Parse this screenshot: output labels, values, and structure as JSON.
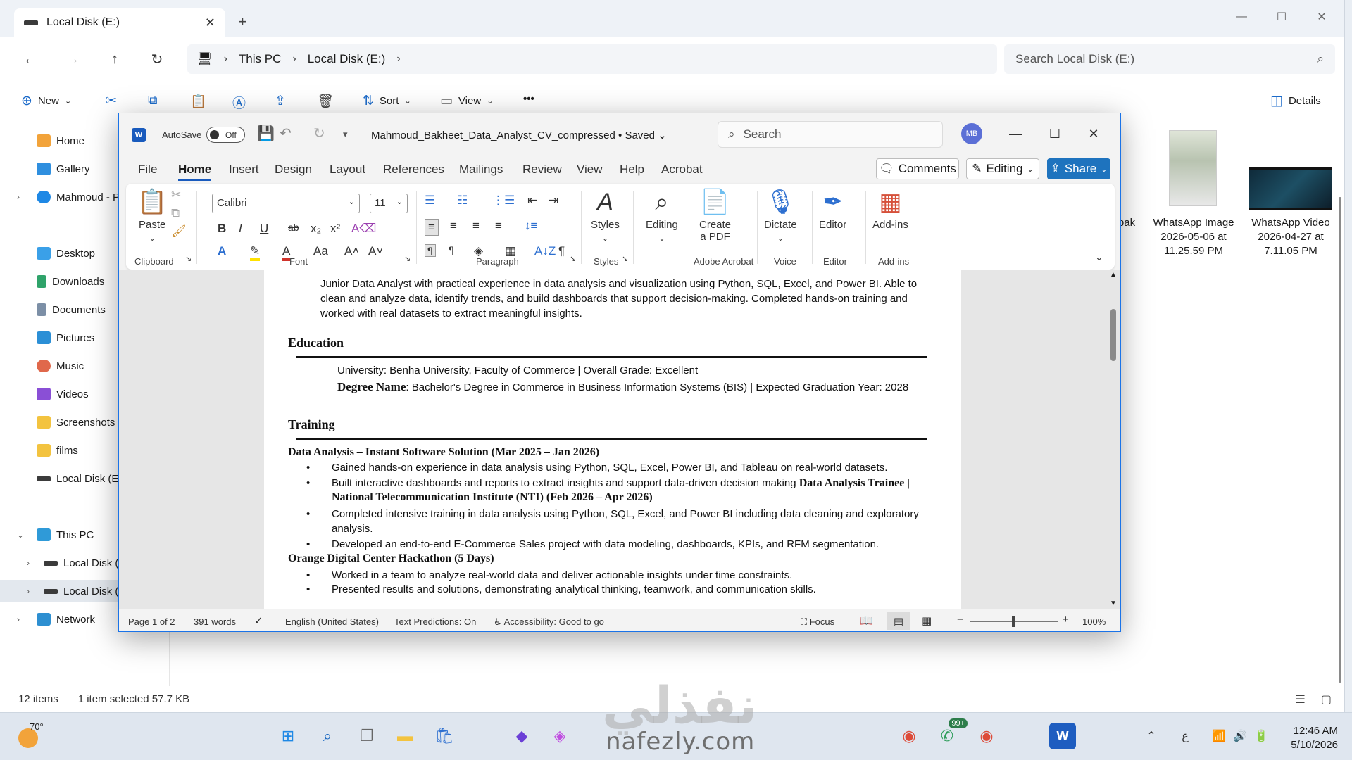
{
  "explorer": {
    "tab_title": "Local Disk (E:)",
    "breadcrumb": [
      "This PC",
      "Local Disk (E:)"
    ],
    "search_placeholder": "Search Local Disk (E:)",
    "toolbar": {
      "new_label": "New",
      "sort_label": "Sort",
      "view_label": "View",
      "more_label": "•••",
      "details_label": "Details"
    },
    "nav": {
      "home": "Home",
      "gallery": "Gallery",
      "onedrive": "Mahmoud - P",
      "desktop": "Desktop",
      "downloads": "Downloads",
      "documents": "Documents",
      "pictures": "Pictures",
      "music": "Music",
      "videos": "Videos",
      "screenshots": "Screenshots",
      "films": "films",
      "local_disk_quick": "Local Disk (E:)",
      "this_pc": "This PC",
      "local_disk_c": "Local Disk (C",
      "local_disk_e": "Local Disk (E",
      "network": "Network"
    },
    "files": [
      {
        "name": "bak",
        "date": ""
      },
      {
        "name": "WhatsApp Image",
        "date": "2026-05-06 at",
        "time": "11.25.59 PM"
      },
      {
        "name": "WhatsApp Video",
        "date": "2026-04-27 at",
        "time": "7.11.05 PM"
      }
    ],
    "status": {
      "items": "12 items",
      "selection": "1 item selected  57.7 KB"
    }
  },
  "word": {
    "autosave_label": "AutoSave",
    "autosave_state": "Off",
    "doc_title": "Mahmoud_Bakheet_Data_Analyst_CV_compressed • Saved",
    "search_placeholder": "Search",
    "avatar_initials": "MB",
    "menu": [
      "File",
      "Home",
      "Insert",
      "Design",
      "Layout",
      "References",
      "Mailings",
      "Review",
      "View",
      "Help",
      "Acrobat"
    ],
    "comments_label": "Comments",
    "editing_label": "Editing",
    "share_label": "Share",
    "ribbon": {
      "paste_label": "Paste",
      "clipboard_group": "Clipboard",
      "font_name": "Calibri",
      "font_size": "11",
      "font_group": "Font",
      "paragraph_group": "Paragraph",
      "styles_label": "Styles",
      "styles_group": "Styles",
      "editing_label": "Editing",
      "create_pdf_line1": "Create",
      "create_pdf_line2": "a PDF",
      "acrobat_group": "Adobe Acrobat",
      "dictate_label": "Dictate",
      "voice_group": "Voice",
      "editor_label": "Editor",
      "editor_group": "Editor",
      "addins_label": "Add-ins",
      "addins_group": "Add-ins"
    },
    "document": {
      "summary_line1": "Junior Data Analyst with practical experience in data analysis and visualization using Python, SQL, Excel, and Power BI. Able to",
      "summary_line2": "clean and analyze data, identify trends, and build dashboards that support decision-making. Completed hands-on training and",
      "summary_line3": "worked with real datasets to extract meaningful insights.",
      "education_heading": "Education",
      "university_line": "University: Benha University, Faculty of Commerce | Overall Grade: Excellent",
      "degree_label": "Degree Name",
      "degree_text": ": Bachelor's Degree in Commerce in Business Information Systems (BIS) | Expected Graduation Year: 2028",
      "training_heading": "Training",
      "training1_title": "Data Analysis – Instant Software Solution (Mar 2025 – Jan 2026)",
      "training1_b1": "Gained hands-on experience in data analysis using Python, SQL, Excel, Power BI, and Tableau on real-world datasets.",
      "training1_b2": "Built interactive dashboards and reports to extract insights and support data-driven decision making ",
      "training2_inline": "Data Analysis Trainee |",
      "training2_line2": "National Telecommunication Institute (NTI) (Feb 2026 – Apr 2026)",
      "training2_b1_line1": "Completed intensive training in data analysis using Python, SQL, Excel, and Power BI including data cleaning and exploratory",
      "training2_b1_line2": "analysis.",
      "training2_b2": "Developed an end-to-end E-Commerce Sales project with data modeling, dashboards, KPIs, and RFM segmentation.",
      "training3_title": "Orange Digital Center Hackathon (5 Days)",
      "training3_b1": "Worked in a team to analyze real-world data and deliver actionable insights under time constraints.",
      "training3_b2": "Presented results and solutions, demonstrating analytical thinking, teamwork, and communication skills."
    },
    "status": {
      "page": "Page 1 of 2",
      "words": "391 words",
      "language": "English (United States)",
      "predictions": "Text Predictions: On",
      "accessibility": "Accessibility: Good to go",
      "focus": "Focus",
      "zoom": "100%"
    }
  },
  "taskbar": {
    "temperature": "70°",
    "watermark": "nafezly.com",
    "watermark_ar": "نفذلي",
    "whatsapp_badge": "99+",
    "time": "12:46 AM",
    "date": "5/10/2026"
  }
}
